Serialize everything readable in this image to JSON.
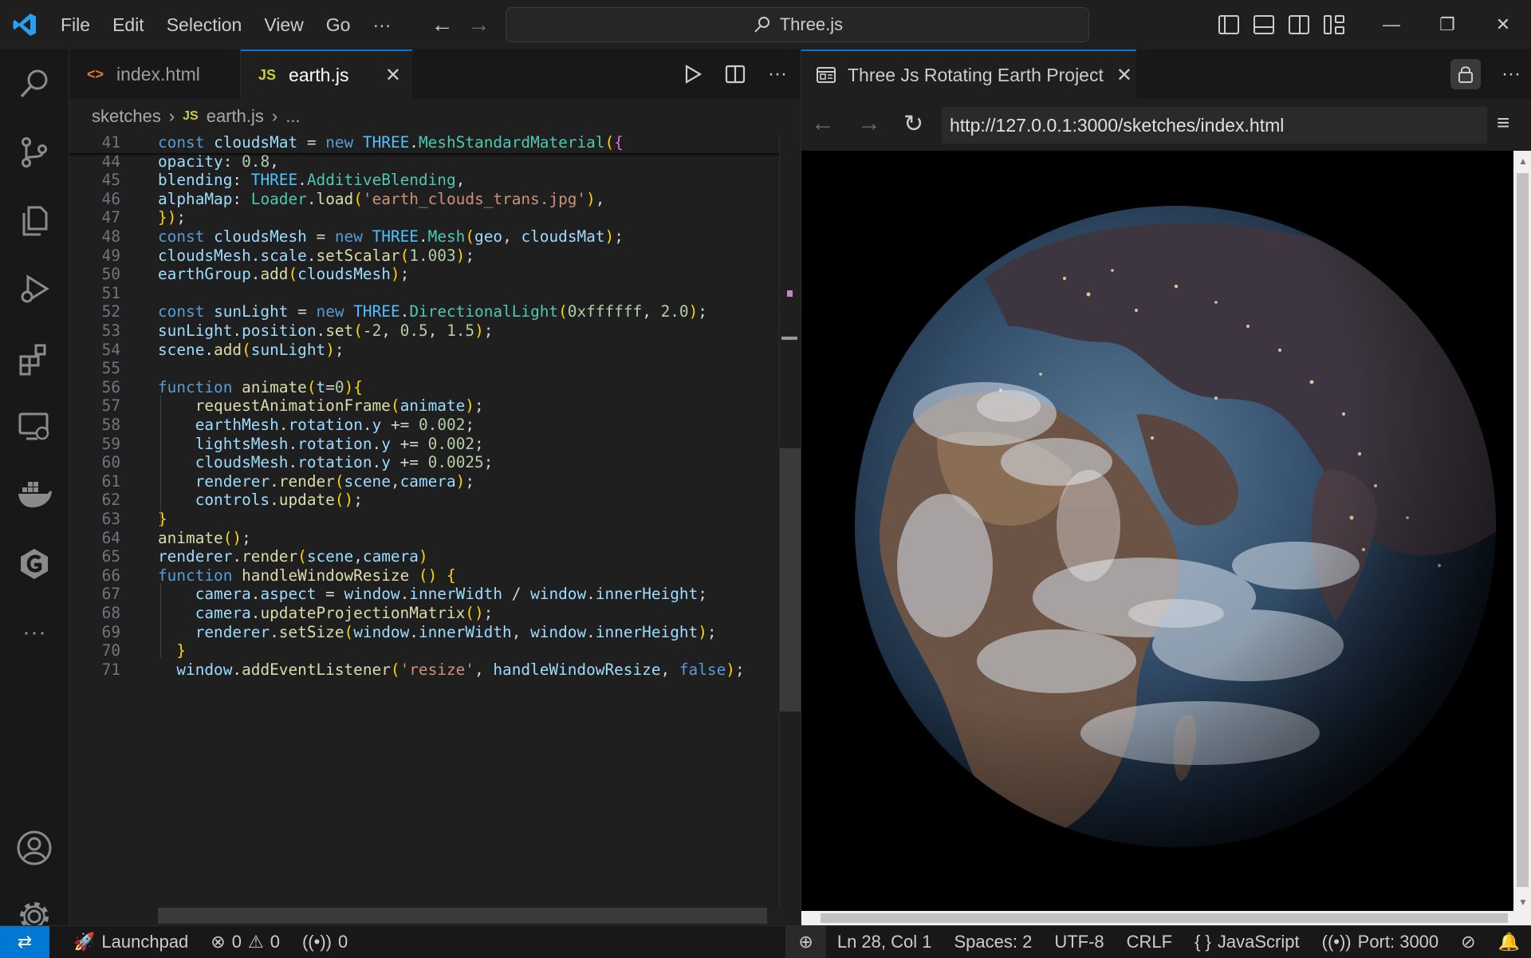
{
  "titlebar": {
    "menus": [
      "File",
      "Edit",
      "Selection",
      "View",
      "Go"
    ],
    "more": "···",
    "search_text": "Three.js"
  },
  "editor": {
    "tabs": [
      {
        "icon": "<>",
        "label": "index.html",
        "active": false
      },
      {
        "icon": "JS",
        "label": "earth.js",
        "active": true
      }
    ],
    "close_glyph": "✕",
    "breadcrumb": {
      "folder": "sketches",
      "file_icon": "JS",
      "file": "earth.js",
      "more": "..."
    },
    "lines": [
      {
        "num": "41",
        "code": "const cloudsMat = new THREE.MeshStandardMaterial({"
      },
      {
        "num": "44",
        "code": "opacity: 0.8,"
      },
      {
        "num": "45",
        "code": "blending: THREE.AdditiveBlending,"
      },
      {
        "num": "46",
        "code": "alphaMap: Loader.load('earth_clouds_trans.jpg'),"
      },
      {
        "num": "47",
        "code": "});"
      },
      {
        "num": "48",
        "code": "const cloudsMesh = new THREE.Mesh(geo, cloudsMat);"
      },
      {
        "num": "49",
        "code": "cloudsMesh.scale.setScalar(1.003);"
      },
      {
        "num": "50",
        "code": "earthGroup.add(cloudsMesh);"
      },
      {
        "num": "51",
        "code": ""
      },
      {
        "num": "52",
        "code": "const sunLight = new THREE.DirectionalLight(0xffffff, 2.0);"
      },
      {
        "num": "53",
        "code": "sunLight.position.set(-2, 0.5, 1.5);"
      },
      {
        "num": "54",
        "code": "scene.add(sunLight);"
      },
      {
        "num": "55",
        "code": ""
      },
      {
        "num": "56",
        "code": "function animate(t=0){"
      },
      {
        "num": "57",
        "code": "    requestAnimationFrame(animate);"
      },
      {
        "num": "58",
        "code": "    earthMesh.rotation.y += 0.002;"
      },
      {
        "num": "59",
        "code": "    lightsMesh.rotation.y += 0.002;"
      },
      {
        "num": "60",
        "code": "    cloudsMesh.rotation.y += 0.0025;"
      },
      {
        "num": "61",
        "code": "    renderer.render(scene,camera);"
      },
      {
        "num": "62",
        "code": "    controls.update();"
      },
      {
        "num": "63",
        "code": "}"
      },
      {
        "num": "64",
        "code": "animate();"
      },
      {
        "num": "65",
        "code": "renderer.render(scene,camera)"
      },
      {
        "num": "66",
        "code": "function handleWindowResize () {"
      },
      {
        "num": "67",
        "code": "    camera.aspect = window.innerWidth / window.innerHeight;"
      },
      {
        "num": "68",
        "code": "    camera.updateProjectionMatrix();"
      },
      {
        "num": "69",
        "code": "    renderer.setSize(window.innerWidth, window.innerHeight);"
      },
      {
        "num": "70",
        "code": "  }"
      },
      {
        "num": "71",
        "code": "  window.addEventListener('resize', handleWindowResize, false);"
      }
    ]
  },
  "browser": {
    "tab_title": "Three Js Rotating Earth Project",
    "url": "http://127.0.0.1:3000/sketches/index.html"
  },
  "status": {
    "launchpad": "Launchpad",
    "errors": "0",
    "warnings": "0",
    "ports_count": "0",
    "position": "Ln 28, Col 1",
    "spaces": "Spaces: 2",
    "encoding": "UTF-8",
    "eol": "CRLF",
    "language": "JavaScript",
    "port": "Port: 3000"
  },
  "colors": {
    "accent": "#0078d4",
    "background": "#1f1f1f",
    "sidebar": "#181818"
  }
}
